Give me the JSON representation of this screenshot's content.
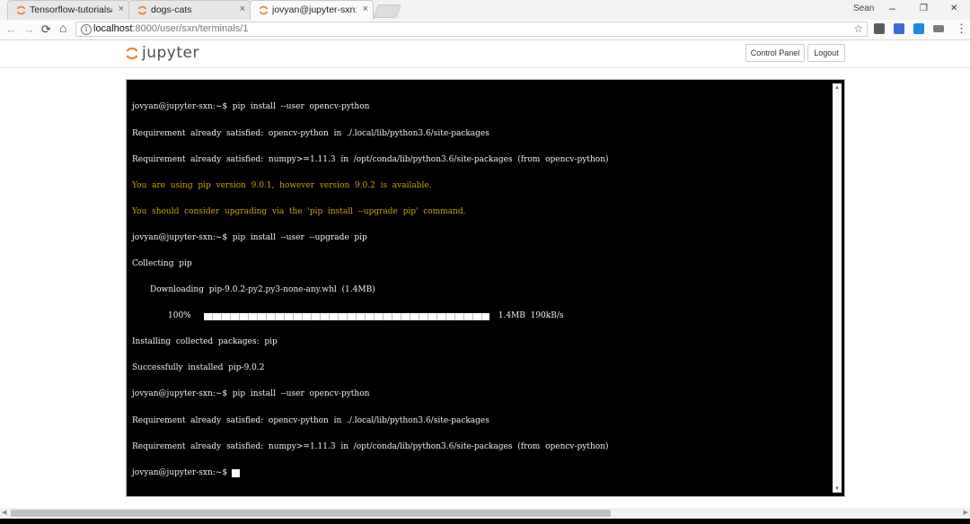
{
  "browser": {
    "tabs": [
      {
        "title": "Tensorflow-tutorials/t",
        "close": "×",
        "active": false
      },
      {
        "title": "dogs-cats",
        "close": "×",
        "active": false
      },
      {
        "title": "jovyan@jupyter-sxn: ~",
        "close": "×",
        "active": true
      }
    ],
    "profile_name": "Sean",
    "window_controls": {
      "minimize": "–",
      "restore": "❐",
      "close": "✕"
    },
    "nav": {
      "back": "←",
      "forward": "→",
      "reload": "⟳",
      "home": "⌂"
    },
    "address": {
      "host": "localhost",
      "path": ":8000/user/sxn/terminals/1",
      "info": "i",
      "star": "☆"
    },
    "extension_colors": [
      "#5b5b5b",
      "#3a6fd8",
      "#1e88e5",
      "#7a7a7a"
    ],
    "menu": "⋮"
  },
  "jupyter": {
    "logo_text": "jupyter",
    "logo_color": "#f37626",
    "control_panel_label": "Control Panel",
    "logout_label": "Logout"
  },
  "terminal": {
    "lines": [
      "jovyan@jupyter-sxn:~$  pip  install  --user  opencv-python",
      "Requirement  already  satisfied:  opencv-python  in  ./.local/lib/python3.6/site-packages",
      "Requirement  already  satisfied:  numpy>=1.11.3  in  /opt/conda/lib/python3.6/site-packages  (from  opencv-python)",
      "You  are  using  pip  version  9.0.1,  however  version  9.0.2  is  available.",
      "You  should  consider  upgrading  via  the  'pip  install  --upgrade  pip'  command.",
      "jovyan@jupyter-sxn:~$  pip  install  --user  --upgrade  pip",
      "Collecting  pip",
      "Downloading  pip-9.0.2-py2.py3-none-any.whl  (1.4MB)",
      "100%",
      "1.4MB  190kB/s",
      "Installing  collected  packages:  pip",
      "Successfully  installed  pip-9.0.2",
      "jovyan@jupyter-sxn:~$  pip  install  --user  opencv-python",
      "Requirement  already  satisfied:  opencv-python  in  ./.local/lib/python3.6/site-packages",
      "Requirement  already  satisfied:  numpy>=1.11.3  in  /opt/conda/lib/python3.6/site-packages  (from  opencv-python)",
      "jovyan@jupyter-sxn:~$"
    ],
    "progress_fraction": 1.0,
    "warning_color": "#c9a400"
  }
}
